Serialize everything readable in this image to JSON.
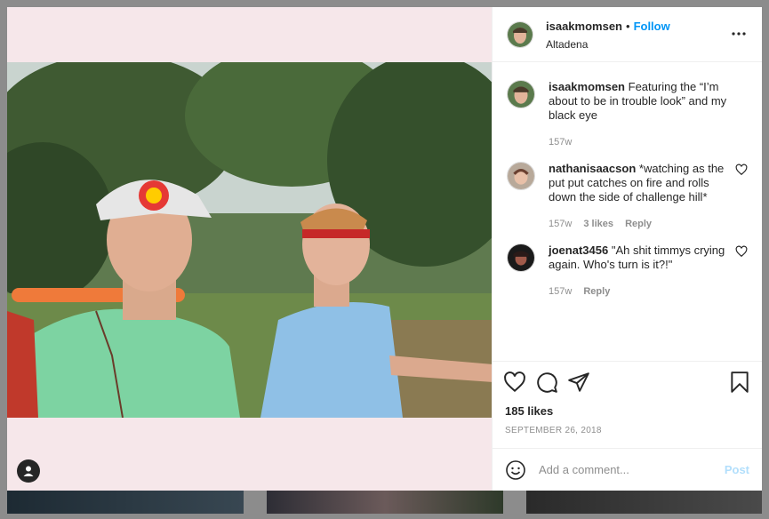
{
  "post": {
    "username": "isaakmomsen",
    "separator": "•",
    "follow_label": "Follow",
    "location": "Altadena",
    "more_icon": "more-horizontal-icon",
    "caption": {
      "username": "isaakmomsen",
      "text": "Featuring the “I’m about to be in trouble look” and my black eye",
      "age": "157w"
    },
    "comments": [
      {
        "username": "nathanisaacson",
        "text": "*watching as the put put catches on fire and rolls down the side of challenge hill*",
        "age": "157w",
        "likes": "3 likes",
        "reply_label": "Reply"
      },
      {
        "username": "joenat3456",
        "text": "\"Ah shit timmys crying again. Who's turn is it?!\"",
        "age": "157w",
        "reply_label": "Reply"
      }
    ],
    "likes": "185 likes",
    "date": "SEPTEMBER 26, 2018",
    "add_comment_placeholder": "Add a comment...",
    "post_label": "Post"
  },
  "colors": {
    "accent": "#0095f6",
    "post_disabled": "#b2dffc",
    "muted": "#8e8e8e",
    "text": "#262626"
  }
}
